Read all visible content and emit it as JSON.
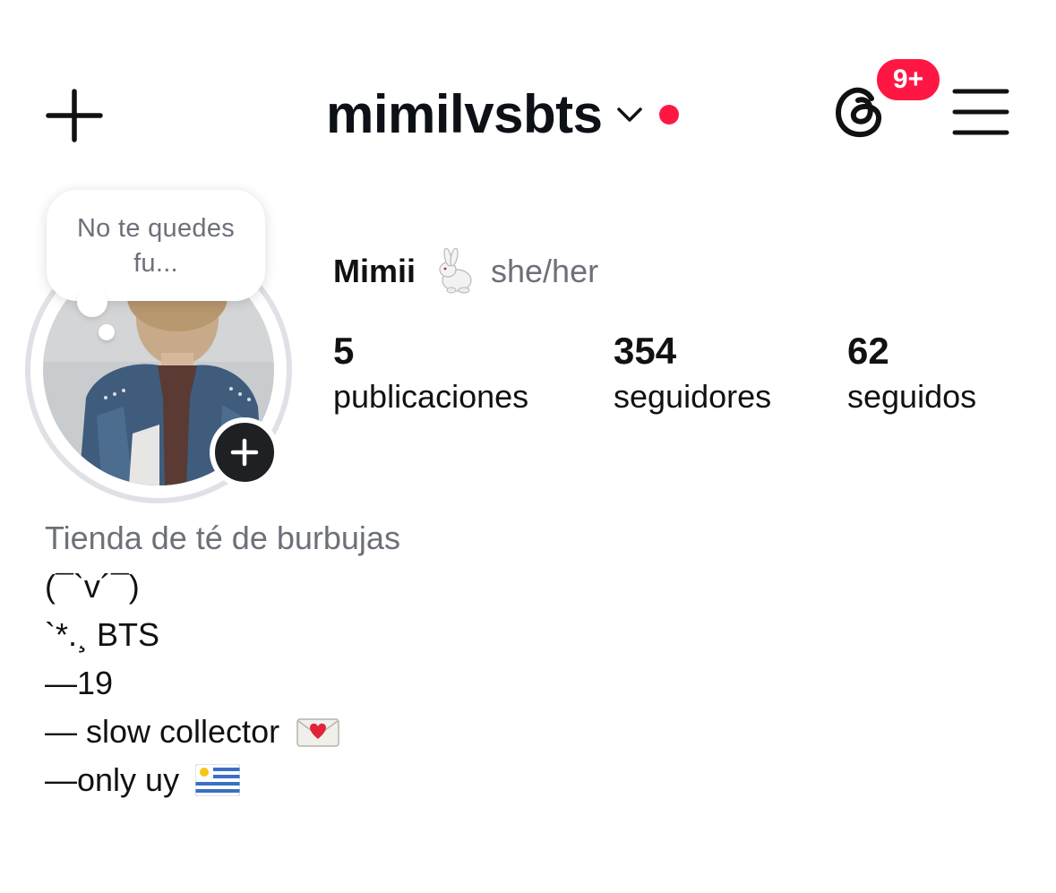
{
  "header": {
    "username": "mimilvsbts",
    "notification_badge": "9+",
    "badge_color": "#ff1744",
    "icons": [
      "plus-icon",
      "chevron-down-icon",
      "threads-icon",
      "hamburger-menu-icon"
    ]
  },
  "note": {
    "text": "No te quedes fu..."
  },
  "profile": {
    "display_name": "Mimii",
    "name_emoji": "rabbit",
    "pronouns": "she/her"
  },
  "stats": {
    "posts": {
      "value": "5",
      "label": "publicaciones"
    },
    "followers": {
      "value": "354",
      "label": "seguidores"
    },
    "following": {
      "value": "62",
      "label": "seguidos"
    }
  },
  "bio": {
    "category": "Tienda de té de burbujas",
    "lines": [
      "(¯`v´¯)",
      "`*.¸ BTS",
      "—19",
      "— slow collector",
      "—only uy"
    ],
    "emojis": [
      "love-letter",
      "uruguay-flag"
    ]
  }
}
